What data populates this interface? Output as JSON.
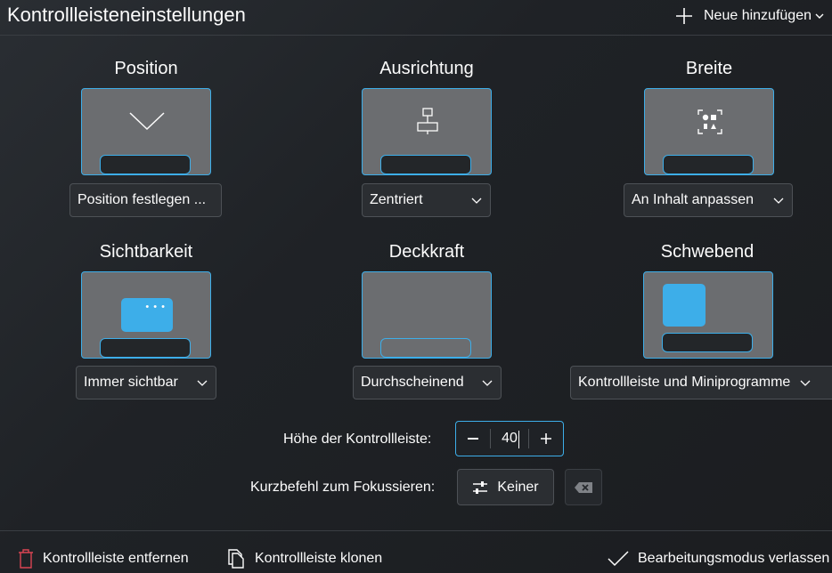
{
  "header": {
    "title": "Kontrollleisteneinstellungen",
    "add_new_label": "Neue hinzufügen"
  },
  "sections": {
    "position": {
      "title": "Position",
      "value": "Position festlegen ..."
    },
    "alignment": {
      "title": "Ausrichtung",
      "value": "Zentriert"
    },
    "width": {
      "title": "Breite",
      "value": "An Inhalt anpassen"
    },
    "visibility": {
      "title": "Sichtbarkeit",
      "value": "Immer sichtbar"
    },
    "opacity": {
      "title": "Deckkraft",
      "value": "Durchscheinend"
    },
    "floating": {
      "title": "Schwebend",
      "value": "Kontrollleiste und Miniprogramme"
    }
  },
  "height": {
    "label": "Höhe der Kontrollleiste:",
    "value": "40"
  },
  "shortcut": {
    "label": "Kurzbefehl zum Fokussieren:",
    "value": "Keiner"
  },
  "footer": {
    "remove_label": "Kontrollleiste entfernen",
    "clone_label": "Kontrollleiste klonen",
    "exit_label": "Bearbeitungsmodus verlassen"
  },
  "colors": {
    "accent": "#3daee9",
    "danger": "#da4453",
    "preview_bg": "#6b6d70",
    "background": "#202326"
  },
  "icons": {
    "add": "plus-icon",
    "position": "chevron-down-icon",
    "alignment": "align-center-icon",
    "width": "fit-content-icon",
    "shortcut": "settings-sliders-icon",
    "clear": "backspace-icon",
    "remove": "trash-icon",
    "clone": "clone-icon",
    "exit": "checkmark-icon"
  }
}
